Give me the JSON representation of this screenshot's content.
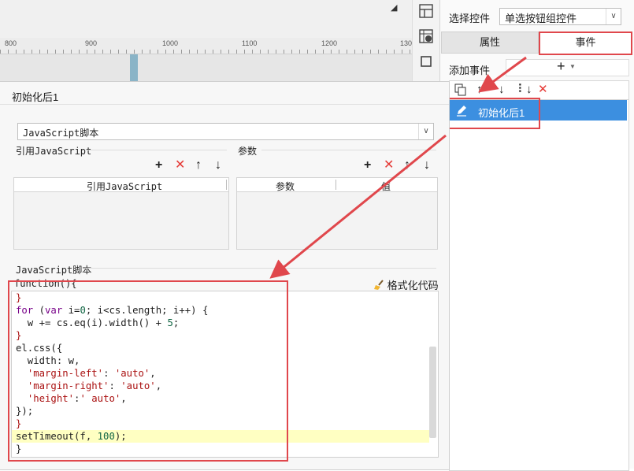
{
  "ruler": {
    "ticks": [
      "800",
      "900",
      "1000",
      "1100",
      "1200",
      "130"
    ]
  },
  "right_panel": {
    "select_control_label": "选择控件",
    "select_control_value": "单选按钮组控件",
    "tabs": {
      "properties": "属性",
      "events": "事件"
    },
    "add_event_label": "添加事件",
    "add_event_button": "+",
    "event_items": [
      "初始化后1"
    ]
  },
  "dialog": {
    "title": "初始化后1",
    "script_type": "JavaScript脚本",
    "ref_js_section": "引用JavaScript",
    "ref_js_column": "引用JavaScript",
    "params_section": "参数",
    "params_columns": [
      "参数",
      "值"
    ],
    "script_section": "JavaScript脚本",
    "function_header": "function(){",
    "format_button": "格式化代码"
  },
  "code_lines": [
    "}",
    "for (var i=0; i<cs.length; i++) {",
    "  w += cs.eq(i).width() + 5;",
    "}",
    "el.css({",
    "  width: w,",
    "  'margin-left': 'auto',",
    "  'margin-right': 'auto',",
    "  'height':' auto',",
    "});",
    "}",
    "setTimeout(f, 100);",
    "}"
  ],
  "colors": {
    "accent_red": "#e0474c",
    "selection_blue": "#3c8fe0",
    "highlight_line": "#ffffc2"
  }
}
